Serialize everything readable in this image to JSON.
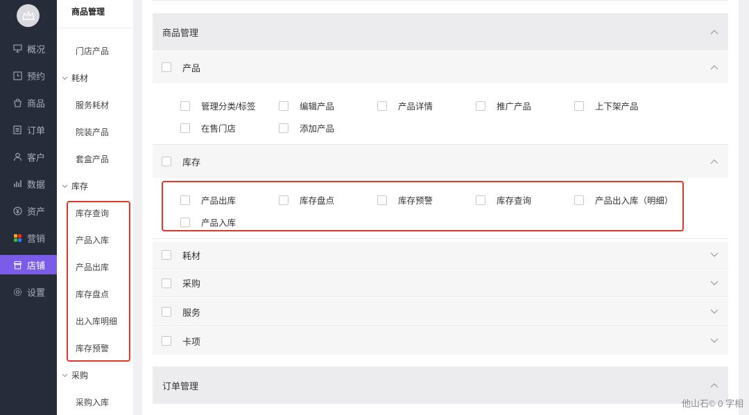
{
  "nav": {
    "items": [
      {
        "label": "概况",
        "icon": "monitor-icon"
      },
      {
        "label": "预约",
        "icon": "clock-icon"
      },
      {
        "label": "商品",
        "icon": "bag-icon"
      },
      {
        "label": "订单",
        "icon": "list-icon"
      },
      {
        "label": "客户",
        "icon": "user-icon"
      },
      {
        "label": "数据",
        "icon": "bar-chart-icon"
      },
      {
        "label": "资产",
        "icon": "yen-icon"
      },
      {
        "label": "营销",
        "icon": "apps-icon"
      },
      {
        "label": "店铺",
        "icon": "store-icon",
        "active": true
      },
      {
        "label": "设置",
        "icon": "gear-icon"
      }
    ]
  },
  "subnav": {
    "title": "商品管理",
    "links": {
      "store_products": "门店产品",
      "consumables_group": "耗材",
      "service_consumables": "服务耗材",
      "packaged_products": "院装产品",
      "boxed_products": "套盒产品",
      "inventory_group": "库存",
      "inventory_query": "库存查询",
      "product_inbound": "产品入库",
      "product_outbound": "产品出库",
      "inventory_count": "库存盘点",
      "inbound_outbound_detail": "出入库明细",
      "inventory_alert": "库存预警",
      "purchase_group": "采购",
      "purchase_inbound": "采购入库"
    }
  },
  "main": {
    "goods_panel_title": "商品管理",
    "product_section": {
      "label": "产品",
      "perms": [
        "管理分类/标签",
        "编辑产品",
        "产品详情",
        "推广产品",
        "上下架产品",
        "在售门店",
        "添加产品"
      ]
    },
    "inventory_section": {
      "label": "库存",
      "perms": [
        "产品出库",
        "库存盘点",
        "库存预警",
        "库存查询",
        "产品出入库（明细）",
        "产品入库"
      ]
    },
    "collapsed_sections": [
      "耗材",
      "采购",
      "服务",
      "卡项"
    ],
    "order_panel_title": "订单管理"
  },
  "watermark": "他山石© 0 字相",
  "colors": {
    "sidebar_bg": "#262c3a",
    "active": "#7b5ce9",
    "highlight": "#e0352b"
  }
}
